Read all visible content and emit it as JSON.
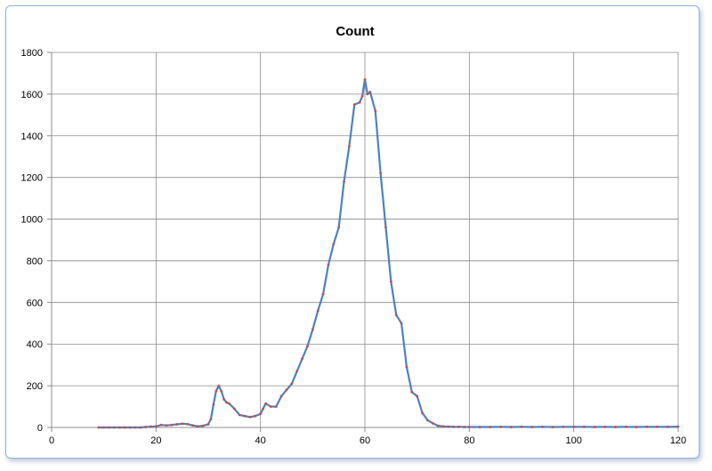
{
  "chart_data": {
    "type": "line",
    "title": "Count",
    "xlabel": "",
    "ylabel": "",
    "xlim": [
      0,
      120
    ],
    "ylim": [
      0,
      1800
    ],
    "x_ticks": [
      0,
      20,
      40,
      60,
      80,
      100,
      120
    ],
    "y_ticks": [
      0,
      200,
      400,
      600,
      800,
      1000,
      1200,
      1400,
      1600,
      1800
    ],
    "grid": true,
    "legend": "none",
    "line_color": "#4f81bd",
    "marker_color": "#c0504d",
    "series": [
      {
        "x": [
          9,
          10,
          11,
          12,
          13,
          14,
          15,
          16,
          17,
          18,
          19,
          20,
          21,
          22,
          23,
          24,
          25,
          26,
          27,
          28,
          29,
          30,
          30.5,
          31,
          31.5,
          32,
          32.5,
          33,
          33.5,
          34,
          35,
          36,
          37,
          38,
          39,
          40,
          40.5,
          41,
          42,
          43,
          44,
          45,
          46,
          47,
          48,
          49,
          50,
          51,
          52,
          53,
          54,
          55,
          56,
          57,
          58,
          59,
          59.5,
          60,
          60.5,
          61,
          62,
          63,
          64,
          65,
          66,
          67,
          68,
          69,
          70,
          71,
          72,
          73,
          74,
          75,
          76,
          77,
          78,
          79,
          80,
          82,
          84,
          86,
          88,
          90,
          92,
          94,
          96,
          98,
          100,
          102,
          104,
          106,
          108,
          110,
          112,
          114,
          116,
          118,
          120
        ],
        "y": [
          0,
          0,
          0,
          0,
          0,
          0,
          0,
          0,
          0,
          2,
          4,
          5,
          12,
          10,
          12,
          15,
          18,
          16,
          10,
          5,
          8,
          15,
          40,
          110,
          175,
          200,
          175,
          135,
          120,
          115,
          90,
          60,
          55,
          50,
          55,
          65,
          90,
          115,
          100,
          100,
          150,
          180,
          210,
          270,
          330,
          390,
          470,
          560,
          640,
          780,
          880,
          960,
          1180,
          1350,
          1550,
          1560,
          1590,
          1670,
          1600,
          1610,
          1520,
          1220,
          960,
          700,
          540,
          500,
          290,
          170,
          150,
          70,
          35,
          20,
          8,
          5,
          4,
          3,
          3,
          2,
          2,
          2,
          2,
          3,
          2,
          3,
          2,
          3,
          2,
          3,
          3,
          3,
          2,
          3,
          2,
          3,
          2,
          3,
          3,
          3,
          4
        ]
      }
    ]
  }
}
